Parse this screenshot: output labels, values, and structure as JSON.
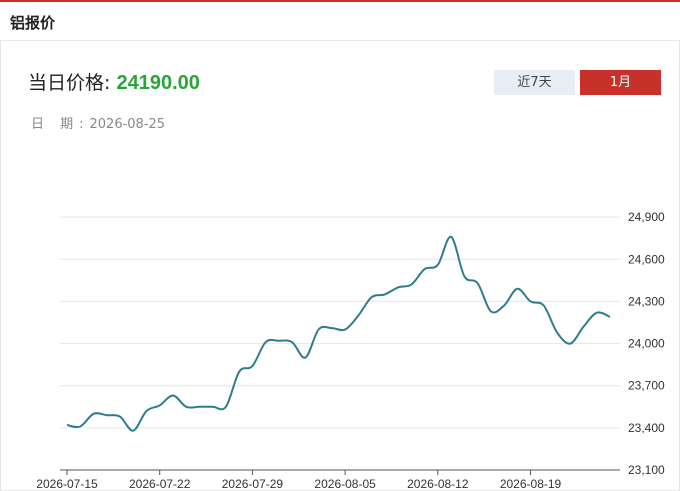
{
  "header": {
    "title": "铝报价"
  },
  "price": {
    "label": "当日价格:",
    "value": "24190.00"
  },
  "date": {
    "label": "日 期:",
    "value": "2026-08-25"
  },
  "range_buttons": {
    "week_label": "近7天",
    "month_label": "1月"
  },
  "colors": {
    "accent": "#c7312a",
    "price_green": "#2aa536",
    "line": "#2e7d8c",
    "grid": "#e6e6e6"
  },
  "chart_data": {
    "type": "line",
    "title": "",
    "xlabel": "",
    "ylabel": "",
    "ylim": [
      23100,
      25200
    ],
    "yticks": [
      23100,
      23400,
      23700,
      24000,
      24300,
      24600,
      24900
    ],
    "ytick_labels": [
      "23,100",
      "23,400",
      "23,700",
      "24,000",
      "24,300",
      "24,600",
      "24,900"
    ],
    "xticks": [
      "2026-07-15",
      "2026-07-22",
      "2026-07-29",
      "2026-08-05",
      "2026-08-12",
      "2026-08-19"
    ],
    "grid": true,
    "legend": "none",
    "series": [
      {
        "x": [
          "2026-07-15",
          "2026-07-16",
          "2026-07-17",
          "2026-07-18",
          "2026-07-19",
          "2026-07-20",
          "2026-07-21",
          "2026-07-22",
          "2026-07-23",
          "2026-07-24",
          "2026-07-25",
          "2026-07-26",
          "2026-07-27",
          "2026-07-28",
          "2026-07-29",
          "2026-07-30",
          "2026-07-31",
          "2026-08-01",
          "2026-08-02",
          "2026-08-03",
          "2026-08-04",
          "2026-08-05",
          "2026-08-06",
          "2026-08-07",
          "2026-08-08",
          "2026-08-09",
          "2026-08-10",
          "2026-08-11",
          "2026-08-12",
          "2026-08-13",
          "2026-08-14",
          "2026-08-15",
          "2026-08-16",
          "2026-08-17",
          "2026-08-18",
          "2026-08-19",
          "2026-08-20",
          "2026-08-21",
          "2026-08-22",
          "2026-08-23",
          "2026-08-24",
          "2026-08-25"
        ],
        "values": [
          23420,
          23410,
          23500,
          23490,
          23480,
          23380,
          23520,
          23560,
          23630,
          23550,
          23550,
          23550,
          23550,
          23800,
          23840,
          24010,
          24020,
          24010,
          23900,
          24100,
          24110,
          24100,
          24200,
          24330,
          24350,
          24400,
          24420,
          24530,
          24560,
          24760,
          24480,
          24430,
          24230,
          24270,
          24390,
          24300,
          24270,
          24080,
          24000,
          24120,
          24220,
          24190
        ]
      }
    ]
  }
}
